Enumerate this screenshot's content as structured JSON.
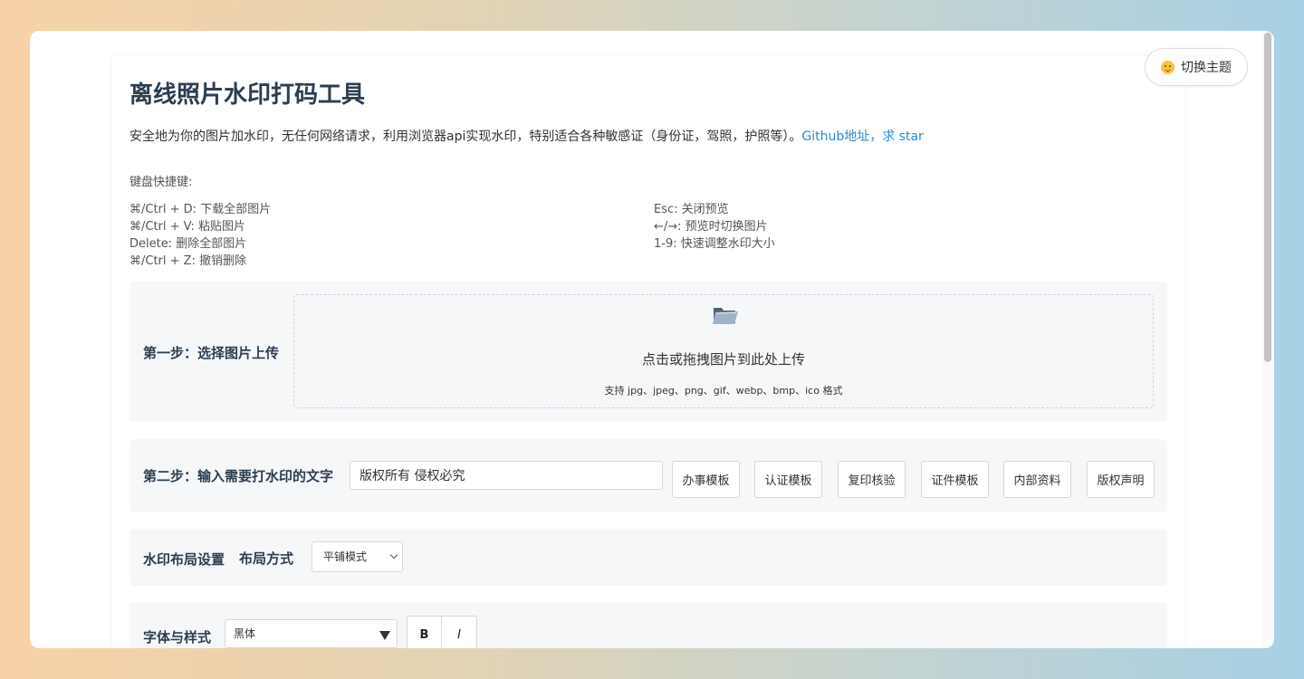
{
  "header": {
    "title": "离线照片水印打码工具",
    "description": "安全地为你的图片加水印，无任何网络请求，利用浏览器api实现水印，特别适合各种敏感证（身份证，驾照，护照等）。",
    "github_link": "Github地址，求 star",
    "theme_button": "切换主题",
    "theme_icon": "smile-icon"
  },
  "shortcuts": {
    "title": "键盘快捷键:",
    "left": [
      "⌘/Ctrl + D: 下载全部图片",
      "⌘/Ctrl + V: 粘贴图片",
      "Delete: 删除全部图片",
      "⌘/Ctrl + Z: 撤销删除"
    ],
    "right": [
      "Esc: 关闭预览",
      "←/→: 预览时切换图片",
      "1-9: 快速调整水印大小"
    ]
  },
  "step1": {
    "label": "第一步：选择图片上传",
    "icon": "folder-icon",
    "upload_text": "点击或拖拽图片到此处上传",
    "formats": "支持 jpg、jpeg、png、gif、webp、bmp、ico 格式"
  },
  "step2": {
    "label": "第二步：输入需要打水印的文字",
    "input_value": "版权所有 侵权必究",
    "templates": [
      "办事模板",
      "认证模板",
      "复印核验",
      "证件模板",
      "内部资料",
      "版权声明"
    ]
  },
  "layout": {
    "label": "水印布局设置",
    "mode_label": "布局方式",
    "mode_value": "平铺模式"
  },
  "font": {
    "label": "字体与样式",
    "font_value": "黑体",
    "bold": "B",
    "italic": "I"
  },
  "colors": {
    "link": "#2a8ad4",
    "section_bg": "#f6f7f9",
    "title": "#2c3e50"
  }
}
